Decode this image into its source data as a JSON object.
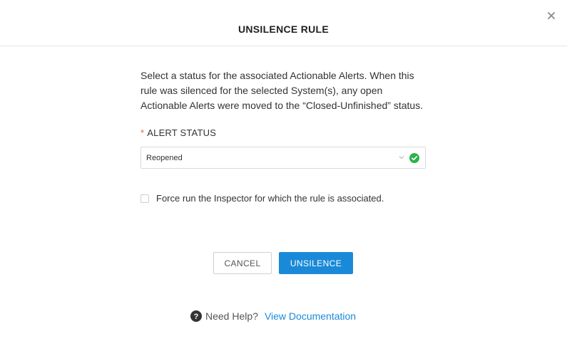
{
  "dialog": {
    "title": "UNSILENCE RULE",
    "close_icon": "close-icon"
  },
  "content": {
    "description": "Select a status for the associated Actionable Alerts. When this rule was silenced for the selected System(s), any open Actionable Alerts were moved to the “Closed-Unfinished” status.",
    "alert_status": {
      "required_marker": "*",
      "label": "ALERT STATUS",
      "selected_value": "Reopened",
      "chevron_icon": "chevron-down-icon",
      "valid_icon": "check-circle-icon"
    },
    "force_run": {
      "checked": false,
      "label": "Force run the Inspector for which the rule is associated."
    }
  },
  "actions": {
    "cancel_label": "CANCEL",
    "unsilence_label": "UNSILENCE"
  },
  "help": {
    "icon": "question-circle-icon",
    "text": "Need Help?",
    "link_text": "View Documentation"
  },
  "colors": {
    "primary": "#1a8ad8",
    "valid": "#2bb34a",
    "required": "#e8604c"
  }
}
